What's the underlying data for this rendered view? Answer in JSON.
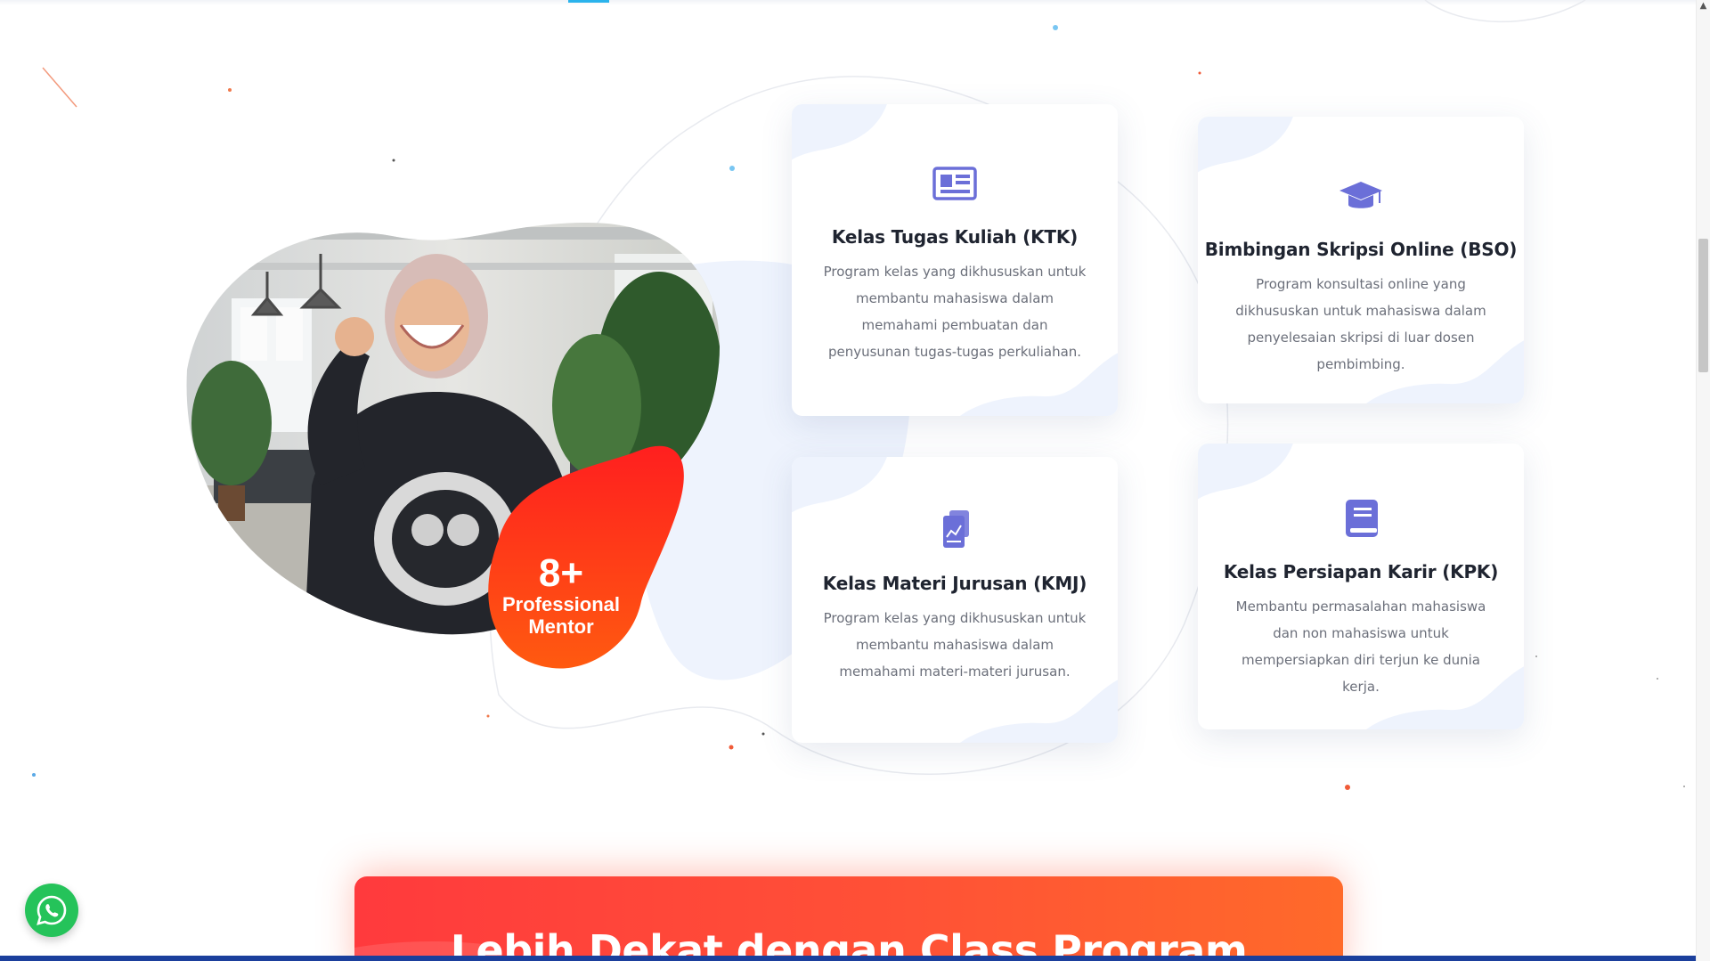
{
  "colors": {
    "accent": "#2bb3ec",
    "icon": "#6b6fd8",
    "cta_start": "#ff3a3d",
    "cta_end": "#ff6a2a",
    "badge": "#ff3d12",
    "whatsapp": "#25c35a",
    "bottom_bar": "#1b3f9c"
  },
  "hero": {
    "badge_number": "8+",
    "badge_line1": "Professional",
    "badge_line2": "Mentor"
  },
  "cards": [
    {
      "icon": "newspaper-icon",
      "title": "Kelas Tugas Kuliah (KTK)",
      "description": "Program kelas yang dikhususkan untuk membantu mahasiswa dalam memahami pembuatan dan penyusunan tugas-tugas perkuliahan."
    },
    {
      "icon": "graduation-cap-icon",
      "title": "Bimbingan Skripsi Online (BSO)",
      "description": "Program konsultasi online yang dikhususkan untuk mahasiswa dalam penyelesaian skripsi di luar dosen pembimbing."
    },
    {
      "icon": "document-chart-icon",
      "title": "Kelas Materi Jurusan (KMJ)",
      "description": "Program kelas yang dikhususkan untuk membantu mahasiswa dalam memahami materi-materi jurusan."
    },
    {
      "icon": "book-icon",
      "title": "Kelas Persiapan Karir (KPK)",
      "description": "Membantu permasalahan mahasiswa dan non mahasiswa untuk mempersiapkan diri terjun ke dunia kerja."
    }
  ],
  "cta": {
    "title": "Lebih Dekat dengan Class Program"
  },
  "whatsapp": {
    "icon": "whatsapp-icon"
  }
}
